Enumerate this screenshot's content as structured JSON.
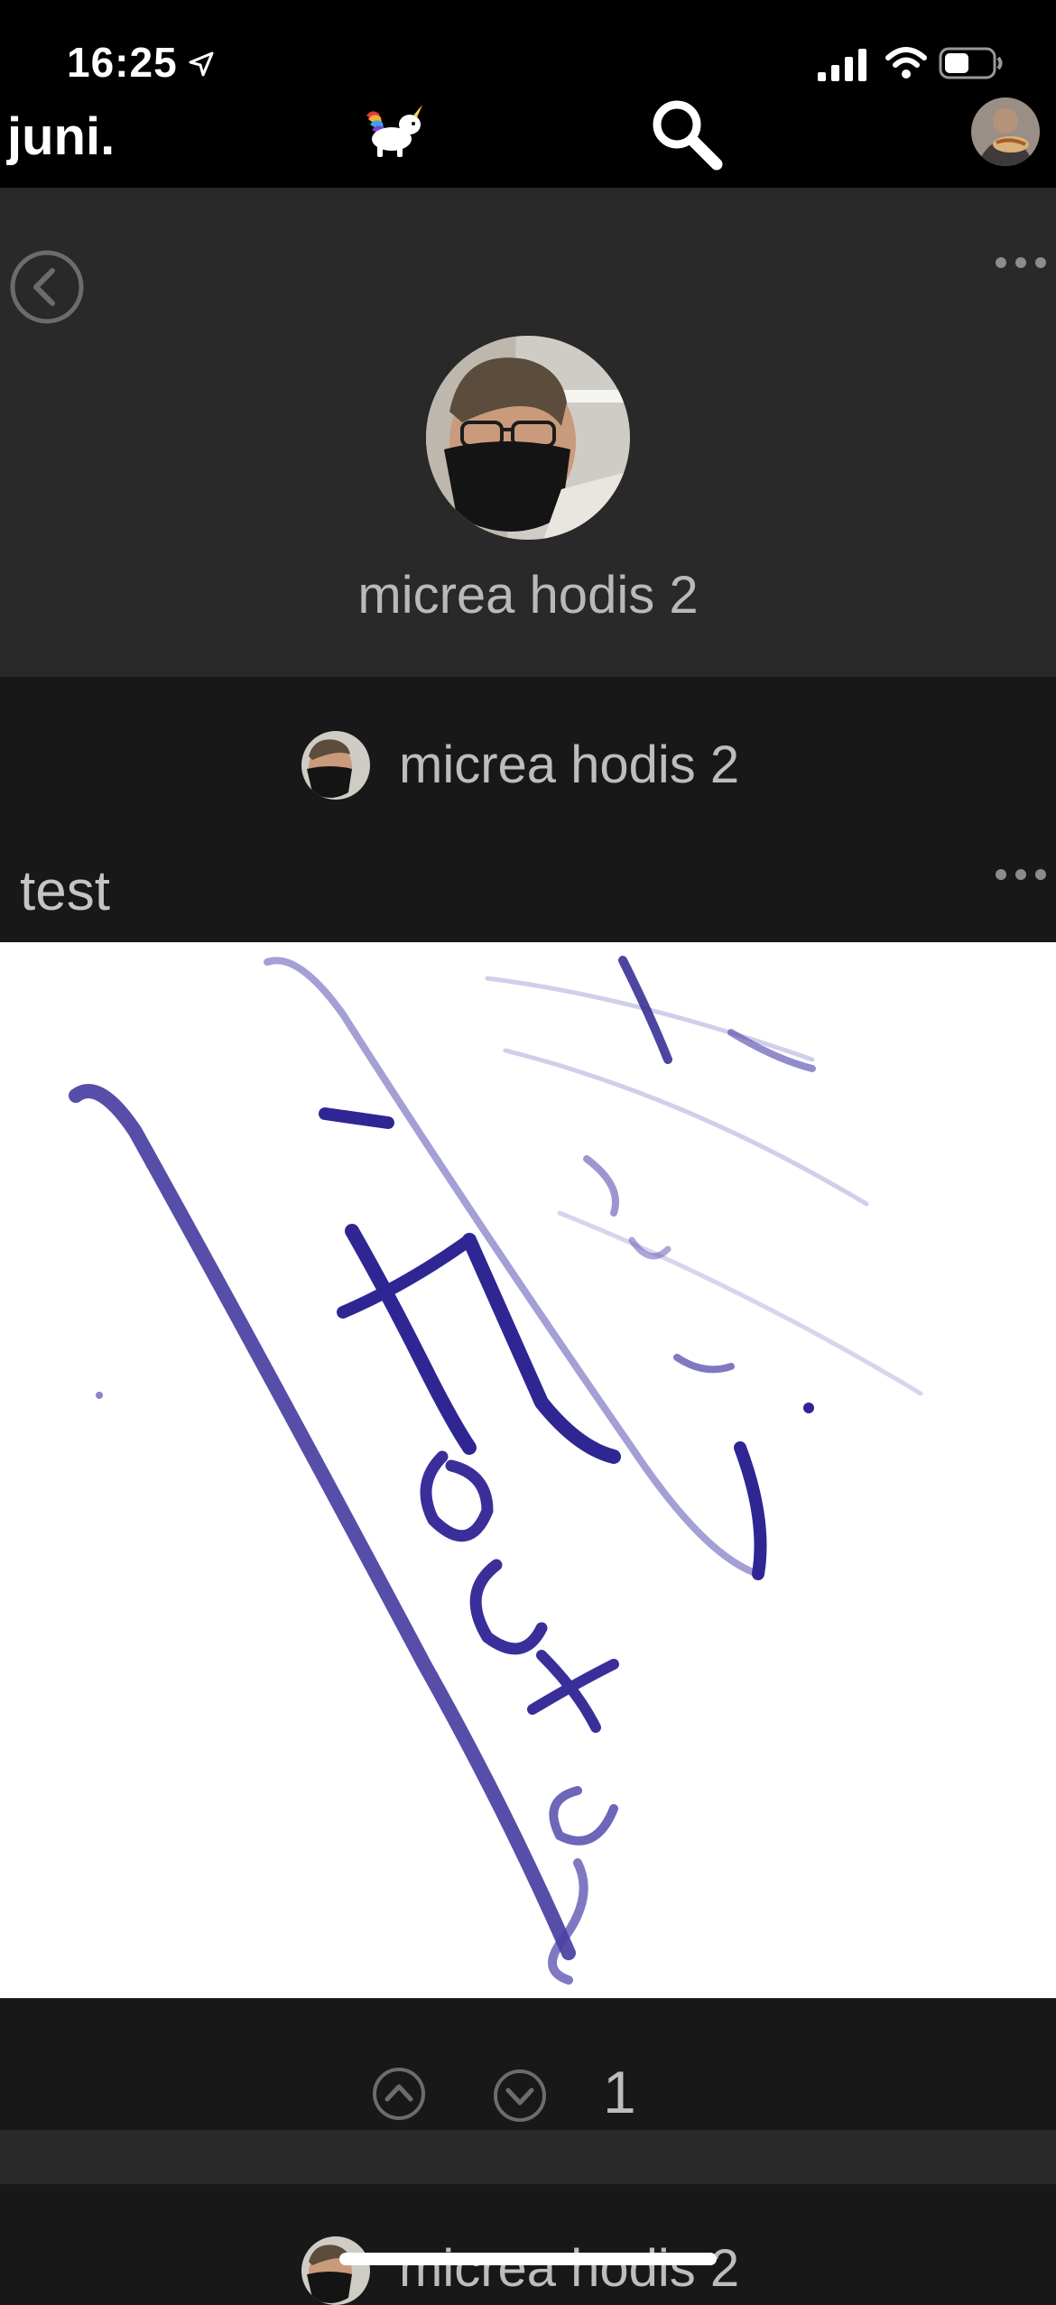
{
  "status_bar": {
    "time": "16:25"
  },
  "nav": {
    "brand": "juni.",
    "logo_icon": "unicorn-icon",
    "search_icon": "search-icon"
  },
  "profile": {
    "name": "micrea hodis 2",
    "back_icon": "chevron-left-icon",
    "more_icon": "more-horizontal-icon"
  },
  "post": {
    "author": "micrea hodis 2",
    "title": "test",
    "score": "1",
    "upvote_icon": "chevron-up-icon",
    "downvote_icon": "chevron-down-icon"
  },
  "next_post": {
    "author": "micrea hodis 2"
  },
  "colors": {
    "background": "#181818",
    "panel": "#292929",
    "topbar": "#000000",
    "ink": "#3a2f9a"
  }
}
